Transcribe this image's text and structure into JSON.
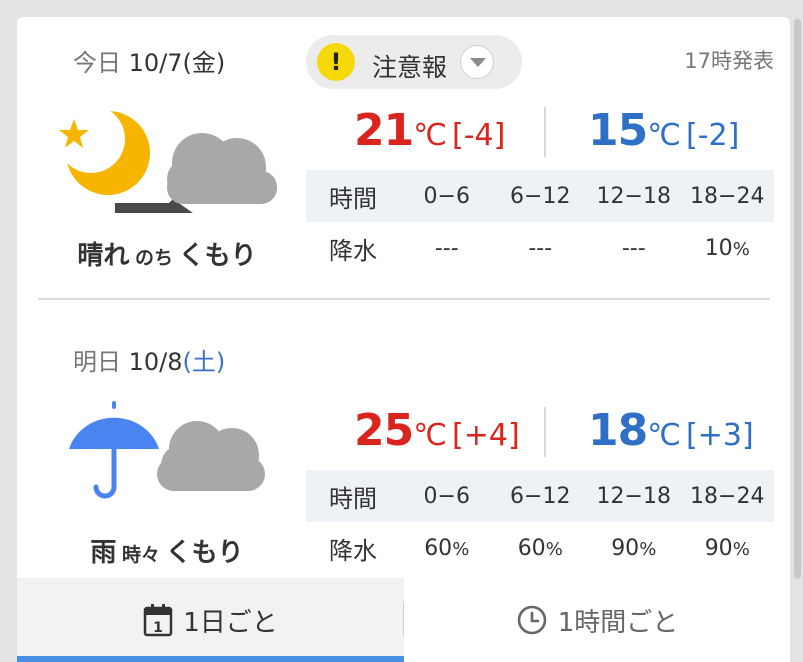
{
  "today": {
    "date_prefix": "今日",
    "date_main": "10/7(金)",
    "warning": {
      "label": "注意報",
      "badge": "!",
      "color": "#f5d90a"
    },
    "announce": "17時発表",
    "icon": "moon-star-then-cloud-icon",
    "condition": {
      "main": "晴れ",
      "joiner": "のち",
      "after": "くもり"
    },
    "high": {
      "value": "21",
      "unit": "℃",
      "diff": "[-4]",
      "color": "#d9251d"
    },
    "low": {
      "value": "15",
      "unit": "℃",
      "diff": "[-2]",
      "color": "#2f6fc6"
    },
    "precip": {
      "header_label": "時間",
      "periods": [
        "0−6",
        "6−12",
        "12−18",
        "18−24"
      ],
      "row_label": "降水",
      "values": [
        {
          "num": "---",
          "unit": ""
        },
        {
          "num": "---",
          "unit": ""
        },
        {
          "num": "---",
          "unit": ""
        },
        {
          "num": "10",
          "unit": "%"
        }
      ]
    }
  },
  "tomorrow": {
    "date_prefix": "明日",
    "date_main": "10/8",
    "date_day": "(土)",
    "icon": "umbrella-and-cloud-icon",
    "condition": {
      "main": "雨",
      "joiner": "時々",
      "after": "くもり"
    },
    "high": {
      "value": "25",
      "unit": "℃",
      "diff": "[+4]",
      "color": "#d9251d"
    },
    "low": {
      "value": "18",
      "unit": "℃",
      "diff": "[+3]",
      "color": "#2f6fc6"
    },
    "precip": {
      "header_label": "時間",
      "periods": [
        "0−6",
        "6−12",
        "12−18",
        "18−24"
      ],
      "row_label": "降水",
      "values": [
        {
          "num": "60",
          "unit": "%"
        },
        {
          "num": "60",
          "unit": "%"
        },
        {
          "num": "90",
          "unit": "%"
        },
        {
          "num": "90",
          "unit": "%"
        }
      ]
    }
  },
  "tabs": {
    "daily": {
      "label": "1日ごと",
      "icon": "calendar-icon",
      "calendar_digit": "1",
      "active": true
    },
    "hourly": {
      "label": "1時間ごと",
      "icon": "clock-icon",
      "active": false
    }
  },
  "colors": {
    "accent": "#4a90e2",
    "high_temp": "#d9251d",
    "low_temp": "#2f6fc6",
    "moon": "#f7b500"
  }
}
